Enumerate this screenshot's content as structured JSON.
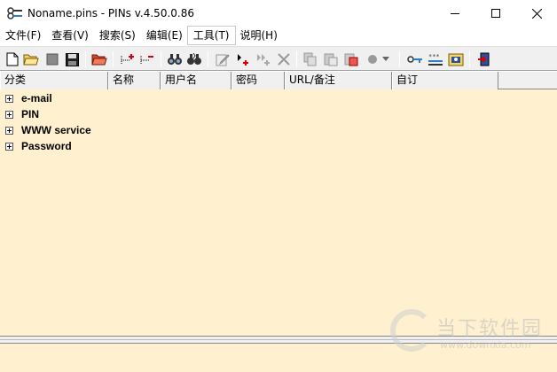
{
  "window": {
    "title": "Noname.pins - PINs v.4.50.0.86"
  },
  "menu": {
    "items": [
      {
        "label": "文件(F)"
      },
      {
        "label": "查看(V)"
      },
      {
        "label": "搜索(S)"
      },
      {
        "label": "编辑(E)"
      },
      {
        "label": "工具(T)"
      },
      {
        "label": "说明(H)"
      }
    ]
  },
  "toolbar": {
    "icons": [
      "new-file-icon",
      "open-folder-icon",
      "close-file-icon",
      "save-icon",
      "open-red-folder-icon",
      "add-category-icon",
      "delete-category-icon",
      "find-icon",
      "find-next-icon",
      "edit-entry-icon",
      "add-entry-icon",
      "add-sub-entry-icon",
      "delete-entry-icon",
      "copy-icon",
      "paste-icon",
      "cut-icon",
      "record-icon",
      "key-icon",
      "password-generator-icon",
      "lock-icon",
      "exit-icon"
    ]
  },
  "table": {
    "columns": [
      {
        "label": "分类"
      },
      {
        "label": "名称"
      },
      {
        "label": "用户名"
      },
      {
        "label": "密码"
      },
      {
        "label": "URL/备注"
      },
      {
        "label": "自订"
      }
    ]
  },
  "tree": {
    "items": [
      {
        "label": "e-mail"
      },
      {
        "label": "PIN"
      },
      {
        "label": "WWW service"
      },
      {
        "label": "Password"
      }
    ]
  },
  "watermark": {
    "name": "当下软件园",
    "url": "www.downxia.com"
  },
  "colors": {
    "pane_background": "#fff1cf",
    "toolbar_background": "#f0f0f0"
  }
}
